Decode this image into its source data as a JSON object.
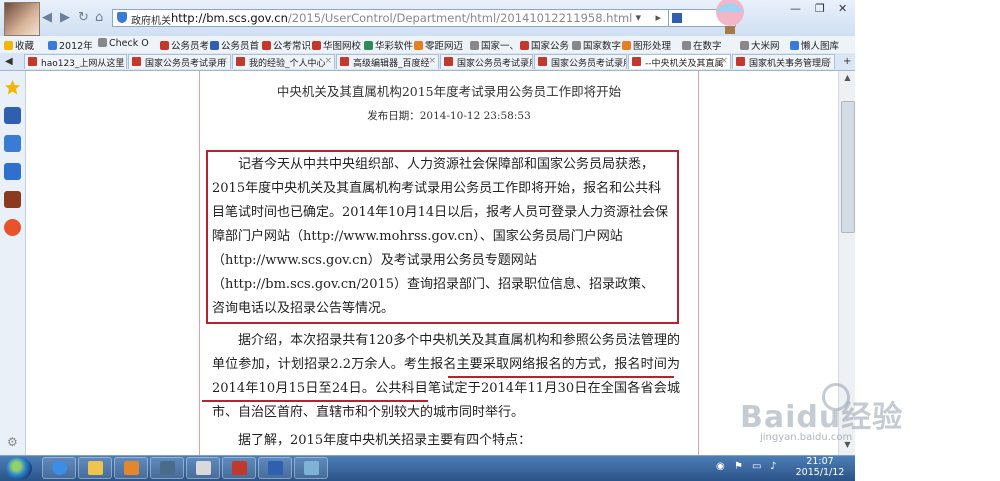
{
  "browser": {
    "address": {
      "security_label": "政府机关",
      "url_host": "http://bm.scs.gov.cn",
      "url_path": "/2015/UserControl/Department/html/20141012211958.html"
    },
    "bookmarks": [
      {
        "label": "收藏",
        "color": "#f2b705"
      },
      {
        "label": "2012年",
        "color": "#3a7bd5"
      },
      {
        "label": "Check O",
        "color": "#888888"
      },
      {
        "label": "公务员考",
        "color": "#c0392b"
      },
      {
        "label": "公务员首",
        "color": "#2f5fb0"
      },
      {
        "label": "公考常识",
        "color": "#c0392b"
      },
      {
        "label": "华图网校",
        "color": "#c0392b"
      },
      {
        "label": "华彩软件",
        "color": "#2e8b57"
      },
      {
        "label": "零距网迈",
        "color": "#e67e22"
      },
      {
        "label": "国家一、",
        "color": "#888888"
      },
      {
        "label": "国家公务",
        "color": "#c0392b"
      },
      {
        "label": "国家数字",
        "color": "#888888"
      },
      {
        "label": "图形处理",
        "color": "#e67e22"
      },
      {
        "label": "在数字",
        "color": "#888888"
      },
      {
        "label": "大米网",
        "color": "#888888"
      },
      {
        "label": "懒人图库",
        "color": "#3a7bd5"
      }
    ],
    "tabs": [
      {
        "label": "hao123_上网从这里"
      },
      {
        "label": "国家公务员考试录用"
      },
      {
        "label": "我的经验_个人中心"
      },
      {
        "label": "高级编辑器_百度经"
      },
      {
        "label": "国家公务员考试录用"
      },
      {
        "label": "国家公务员考试录用"
      },
      {
        "label": "--中央机关及其直属"
      },
      {
        "label": "国家机关事务管理局"
      }
    ]
  },
  "article": {
    "title": "中央机关及其直属机构2015年度考试录用公务员工作即将开始",
    "date": "发布日期：2014-10-12 23:58:53",
    "para1_lines": [
      "记者今天从中共中央组织部、人力资源社会保障部和国家公务员局获悉，",
      "2015年度中央机关及其直属机构考试录用公务员工作即将开始，报名和公共科",
      "目笔试时间也已确定。2014年10月14日以后，报考人员可登录人力资源社会保",
      "障部门户网站（http://www.mohrss.gov.cn）、国家公务员局门户网站",
      "（http://www.scs.gov.cn）及考试录用公务员专题网站",
      "（http://bm.scs.gov.cn/2015）查询招录部门、招录职位信息、招录政策、",
      "咨询电话以及招录公告等情况。"
    ],
    "para2": "据介绍，本次招录共有120多个中央机关及其直属机构和参照公务员法管理的单位参加，计划招录2.2万余人。考生报名主要采取网络报名的方式，报名时间为2014年10月15日至24日。公共科目笔试定于2014年11月30日在全国各省会城市、自治区首府、直辖市和个别较大的城市同时举行。",
    "para3": "据了解，2015年度中央机关招录主要有四个特点："
  },
  "watermark": {
    "brand": "Baidu经验",
    "site": "jingyan.baidu.com"
  },
  "taskbar": {
    "time": "21:07",
    "date": "2015/1/12"
  },
  "colors": {
    "highlight": "#b42331",
    "doc_border": "#e0a3a3"
  }
}
